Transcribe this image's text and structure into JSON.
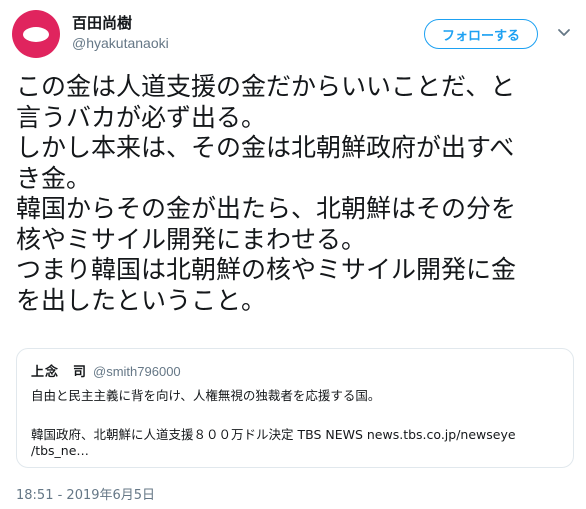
{
  "author": {
    "display_name": "百田尚樹",
    "handle": "@hyakutanaoki"
  },
  "follow_button": {
    "label": "フォローする"
  },
  "tweet": {
    "lines": [
      "この金は人道支援の金だからいいことだ、と",
      "言うバカが必ず出る。",
      "しかし本来は、その金は北朝鮮政府が出すべ",
      "き金。",
      "韓国からその金が出たら、北朝鮮はその分を",
      "核やミサイル開発にまわせる。",
      "つまり韓国は北朝鮮の核やミサイル開発に金",
      "を出したということ。"
    ]
  },
  "quote": {
    "name": "上念　司",
    "handle": "@smith796000",
    "line1": "自由と民主主義に背を向け、人権無視の独裁者を応援する国。",
    "line2": "韓国政府、北朝鮮に人道支援８００万ドル決定 TBS NEWS news.tbs.co.jp/newseye",
    "line3": "/tbs_ne…"
  },
  "timestamp": "18:51 - 2019年6月5日",
  "icons": {
    "avatar": "avatar-icon",
    "more": "chevron-down-icon"
  },
  "colors": {
    "accent": "#1da1f2",
    "avatar": "#e0245e",
    "secondary_text": "#657786",
    "border": "#e1e8ed"
  }
}
